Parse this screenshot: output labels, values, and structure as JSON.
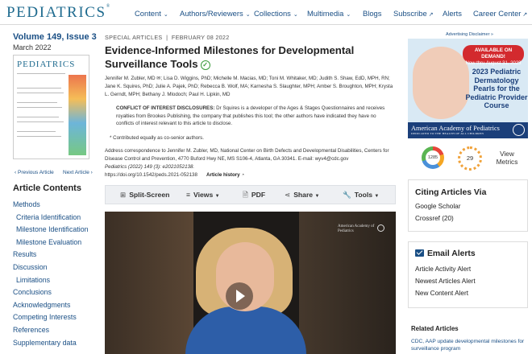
{
  "header": {
    "logo": "PEDIATRICS",
    "logo_mark": "®",
    "nav": [
      {
        "label": "Content",
        "dropdown": true
      },
      {
        "label": "Authors/Reviewers",
        "dropdown": true
      },
      {
        "label": "Collections",
        "dropdown": true
      },
      {
        "label": "Multimedia",
        "dropdown": true
      },
      {
        "label": "Blogs",
        "dropdown": false
      },
      {
        "label": "Subscribe",
        "external": true
      },
      {
        "label": "Alerts",
        "dropdown": false
      },
      {
        "label": "Career Center",
        "external": true
      }
    ]
  },
  "issue": {
    "title": "Volume 149, Issue 3",
    "date": "March 2022",
    "cover_title": "PEDIATRICS",
    "previous": "Previous Article",
    "next": "Next Article"
  },
  "toc": {
    "title": "Article Contents",
    "items": [
      {
        "label": "Methods",
        "level": 0
      },
      {
        "label": "Criteria Identification",
        "level": 1
      },
      {
        "label": "Milestone Identification",
        "level": 1
      },
      {
        "label": "Milestone Evaluation",
        "level": 1
      },
      {
        "label": "Results",
        "level": 0
      },
      {
        "label": "Discussion",
        "level": 0
      },
      {
        "label": "Limitations",
        "level": 1
      },
      {
        "label": "Conclusions",
        "level": 0
      },
      {
        "label": "Acknowledgments",
        "level": 0
      },
      {
        "label": "Competing Interests",
        "level": 0
      },
      {
        "label": "References",
        "level": 0
      },
      {
        "label": "Supplementary data",
        "level": 0
      }
    ]
  },
  "article": {
    "section": "SPECIAL ARTICLES",
    "date": "FEBRUARY 08 2022",
    "title": "Evidence-Informed Milestones for Developmental Surveillance Tools",
    "authors": "Jennifer M. Zubler, MD ✉; Lisa D. Wiggins, PhD; Michelle M. Macias, MD; Toni M. Whitaker, MD; Judith S. Shaw, EdD, MPH, RN; Jane K. Squires, PhD; Julie A. Pajek, PhD; Rebecca B. Wolf, MA; Karnesha S. Slaughter, MPH; Amber S. Broughton, MPH; Krysta L. Gerndt, MPH; Bethany J. Mlodoch; Paul H. Lipkin, MD",
    "coi_label": "CONFLICT OF INTEREST DISCLOSURES:",
    "coi_text": " Dr Squires is a developer of the Ages & Stages Questionnaires and receives royalties from Brookes Publishing, the company that publishes this tool; the other authors have indicated they have no conflicts of interest relevant to this article to disclose.",
    "contrib": "Contributed equally as co-senior authors.",
    "address": "Address correspondence to Jennifer M. Zubler, MD, National Center on Birth Defects and Developmental Disabilities, Centers for Disease Control and Prevention, 4770 Buford Hwy NE, MS S106-4, Atlanta, GA 30341. E-mail: wyv4@cdc.gov",
    "citation": "Pediatrics (2022) 149 (3): e2021052138.",
    "doi": "https://doi.org/10.1542/peds.2021-052138",
    "history": "Article history"
  },
  "toolbar": {
    "split_screen": "Split-Screen",
    "views": "Views",
    "pdf": "PDF",
    "share": "Share",
    "tools": "Tools"
  },
  "video": {
    "brand": "American Academy of Pediatrics"
  },
  "sidebar": {
    "ad_disclaimer": "Advertising Disclaimer »",
    "ad_demand": "AVAILABLE ON DEMAND!",
    "ad_dates": "Now thru August 31, 2023",
    "ad_title": "2023 Pediatric Dermatology Pearls for the Pediatric Provider Course",
    "ad_org": "American Academy of Pediatrics",
    "ad_org_tag": "DEDICATED TO THE HEALTH OF ALL CHILDREN",
    "altmetric_score": "1285",
    "dimensions_score": "29",
    "view_metrics": "View Metrics",
    "citing_title": "Citing Articles Via",
    "citing_links": [
      "Google Scholar",
      "Crossref (20)"
    ],
    "alerts_title": "Email Alerts",
    "alert_links": [
      "Article Activity Alert",
      "Newest Articles Alert",
      "New Content Alert"
    ],
    "related_title": "Related Articles",
    "related_item": "CDC, AAP update developmental milestones for surveillance program"
  }
}
